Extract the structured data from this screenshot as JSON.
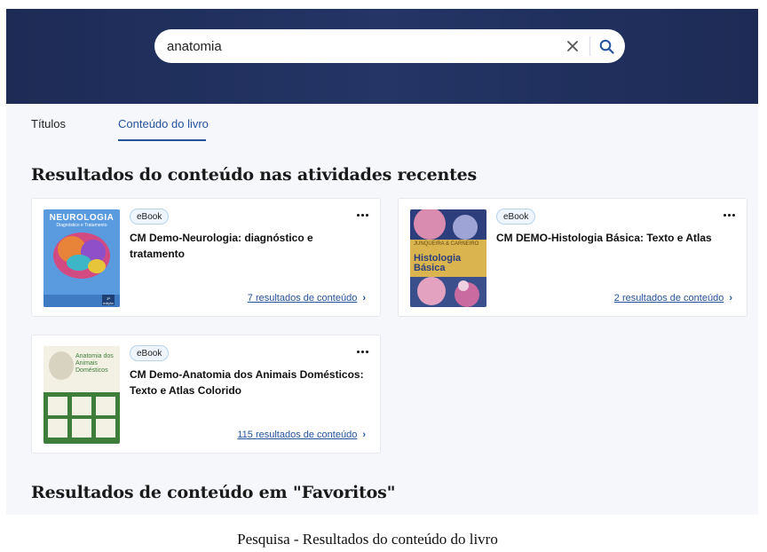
{
  "search": {
    "value": "anatomia"
  },
  "tabs": [
    {
      "label": "Títulos",
      "active": false
    },
    {
      "label": "Conteúdo do livro",
      "active": true
    }
  ],
  "sections": {
    "recent": "Resultados do conteúdo nas atividades recentes",
    "favorites": "Resultados de conteúdo em \"Favoritos\""
  },
  "cards": [
    {
      "badge": "eBook",
      "title": "CM Demo-Neurologia: diagnóstico e tratamento",
      "results": "7 resultados de conteúdo",
      "cover": {
        "line1": "NEUROLOGIA",
        "line2": "Diagnóstico e Tratamento",
        "edition": "3ª edição"
      }
    },
    {
      "badge": "eBook",
      "title": "CM DEMO-Histologia Básica: Texto e Atlas",
      "results": "2 resultados de conteúdo",
      "cover": {
        "line1": "JUNQUEIRA & CARNEIRO",
        "line2": "Histologia Básica"
      }
    },
    {
      "badge": "eBook",
      "title": "CM Demo-Anatomia dos Animais Domésticos: Texto e Atlas Colorido",
      "results": "115 resultados de conteúdo",
      "cover": {
        "line1": "Anatomia dos Animais Domésticos"
      }
    }
  ],
  "caption": "Pesquisa - Resultados do conteúdo do livro",
  "colors": {
    "header": "#1d2b55",
    "accent": "#24539c",
    "badge_border": "#b8d3ee"
  },
  "icons": {
    "clear": "close-icon",
    "search": "search-icon",
    "more": "more-icon",
    "link": "chevron-right-icon"
  }
}
